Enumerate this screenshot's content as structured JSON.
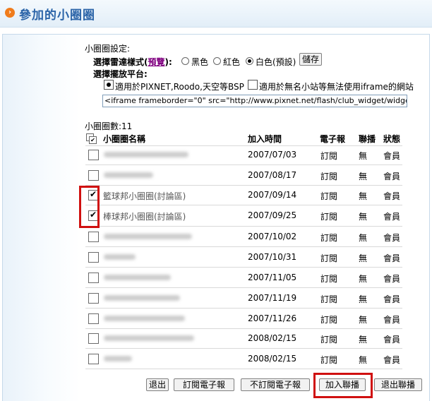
{
  "header": {
    "title": "參加的小圈圈",
    "icon": "arrow-right-icon"
  },
  "settings": {
    "heading": "小圈圈設定:",
    "style_label": "選擇雷達樣式(",
    "preview_link": "預覽",
    "style_label_end": "):",
    "style_options": [
      {
        "label": "黑色",
        "selected": false
      },
      {
        "label": "紅色",
        "selected": false
      },
      {
        "label": "白色(預設)",
        "selected": true
      }
    ],
    "save_button": "儲存",
    "platform_label": "選擇擺放平台:",
    "platform_options": [
      {
        "label": "適用於PIXNET,Roodo,天空等BSP",
        "selected": true
      },
      {
        "label": "適用於無名小站等無法使用iframe的網站",
        "selected": false
      }
    ],
    "embed_code": "<iframe frameborder=\"0\" src=\"http://www.pixnet.net/flash/club_widget/widget.ph"
  },
  "table": {
    "count_text": "小圈圈數:11",
    "columns": [
      "小圈圈名稱",
      "加入時間",
      "電子報",
      "聯播",
      "狀態"
    ],
    "rows": [
      {
        "name": "",
        "date": "2007/07/03",
        "newsletter": "訂閱",
        "syndication": "無",
        "status": "會員",
        "checked": false
      },
      {
        "name": "",
        "date": "2007/08/17",
        "newsletter": "訂閱",
        "syndication": "無",
        "status": "會員",
        "checked": false
      },
      {
        "name": "籃球邦小圈圈(討論區)",
        "date": "2007/09/14",
        "newsletter": "訂閱",
        "syndication": "無",
        "status": "會員",
        "checked": true
      },
      {
        "name": "棒球邦小圈圈(討論區)",
        "date": "2007/09/25",
        "newsletter": "訂閱",
        "syndication": "無",
        "status": "會員",
        "checked": true
      },
      {
        "name": "",
        "date": "2007/10/02",
        "newsletter": "訂閱",
        "syndication": "無",
        "status": "會員",
        "checked": false
      },
      {
        "name": "",
        "date": "2007/10/31",
        "newsletter": "訂閱",
        "syndication": "無",
        "status": "會員",
        "checked": false
      },
      {
        "name": "",
        "date": "2007/11/05",
        "newsletter": "訂閱",
        "syndication": "無",
        "status": "會員",
        "checked": false
      },
      {
        "name": "",
        "date": "2007/11/19",
        "newsletter": "訂閱",
        "syndication": "無",
        "status": "會員",
        "checked": false
      },
      {
        "name": "",
        "date": "2007/11/26",
        "newsletter": "訂閱",
        "syndication": "無",
        "status": "會員",
        "checked": false
      },
      {
        "name": "",
        "date": "2008/02/15",
        "newsletter": "訂閱",
        "syndication": "無",
        "status": "會員",
        "checked": false
      },
      {
        "name": "",
        "date": "2008/02/15",
        "newsletter": "訂閱",
        "syndication": "無",
        "status": "會員",
        "checked": false
      }
    ]
  },
  "actions": {
    "leave": "退出",
    "subscribe": "訂閱電子報",
    "unsubscribe": "不訂閱電子報",
    "join_syndication": "加入聯播",
    "leave_syndication": "退出聯播"
  },
  "colors": {
    "title": "#2b64a8",
    "accent": "#f07c1c",
    "highlight": "#d01010"
  }
}
